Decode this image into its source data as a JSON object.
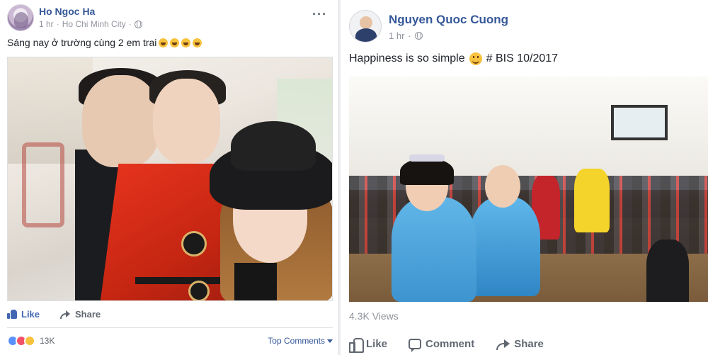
{
  "left_post": {
    "author": "Ho Ngoc Ha",
    "time": "1 hr",
    "separator": "·",
    "location": "Ho Chi Minh City",
    "privacy_icon": "globe-icon",
    "menu_icon": "more-options-icon",
    "menu_label": "···",
    "text": "Sáng nay ở trường cùng 2 em trai",
    "emoji_count": 4,
    "emoji_icon": "laughing-emoji-icon",
    "actions": {
      "like": "Like",
      "share": "Share"
    },
    "like_color": "#4267b2",
    "reactions": [
      "like",
      "love",
      "haha"
    ],
    "reaction_count": "13K",
    "top_comments": "Top Comments"
  },
  "right_post": {
    "author": "Nguyen Quoc Cuong",
    "time": "1 hr",
    "separator": "·",
    "privacy_icon": "globe-icon",
    "text_before": "Happiness is so simple",
    "emoji_icon": "smiley-emoji-icon",
    "text_after": "# BIS 10/2017",
    "views": "4.3K Views",
    "actions": {
      "like": "Like",
      "comment": "Comment",
      "share": "Share"
    }
  },
  "colors": {
    "link_blue": "#365899",
    "meta_gray": "#90949c",
    "action_gray": "#606770",
    "divider": "#dddfe2",
    "background": "#e9ebee"
  }
}
